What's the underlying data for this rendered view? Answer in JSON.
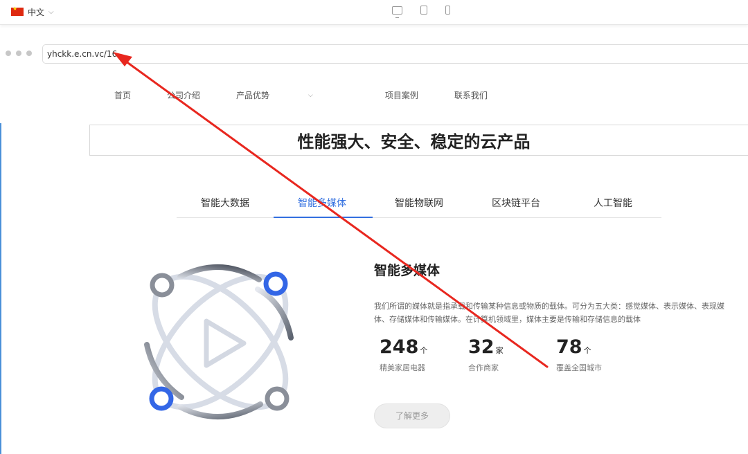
{
  "topbar": {
    "language": "中文",
    "flag_color": "#de2910",
    "devices": [
      "desktop-icon",
      "tablet-icon",
      "phone-icon"
    ]
  },
  "browser": {
    "url": "yhckk.e.cn.vc/16"
  },
  "nav": {
    "items": [
      "首页",
      "公司介绍",
      "产品优势",
      "项目案例",
      "联系我们"
    ]
  },
  "hero": {
    "title": "性能强大、安全、稳定的云产品"
  },
  "tabs": {
    "items": [
      "智能大数据",
      "智能多媒体",
      "智能物联网",
      "区块链平台",
      "人工智能"
    ],
    "active_index": 1,
    "accent_color": "#3370e0"
  },
  "content": {
    "title": "智能多媒体",
    "description": "我们所谓的媒体就是指承载和传输某种信息或物质的载体。可分为五大类：感觉媒体、表示媒体、表现媒体、存储媒体和传输媒体。在计算机领域里，媒体主要是传输和存储信息的载体",
    "stats": [
      {
        "value": "248",
        "unit": "个",
        "label": "精美家居电器"
      },
      {
        "value": "32",
        "unit": "家",
        "label": "合作商家"
      },
      {
        "value": "78",
        "unit": "个",
        "label": "覆盖全国城市"
      }
    ],
    "more_label": "了解更多"
  },
  "annotation": {
    "arrow_color": "#e8271f"
  }
}
